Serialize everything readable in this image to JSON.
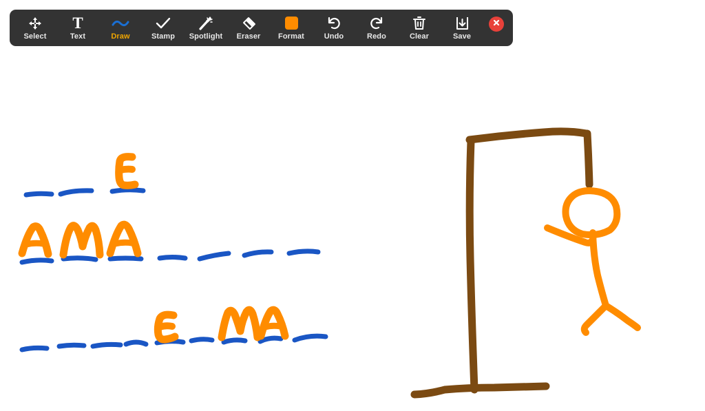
{
  "app": {
    "title": "Zoom Annotation Whiteboard",
    "canvas_background": "#ffffff"
  },
  "toolbar": {
    "background_color": "#333333",
    "active_tool": "Draw",
    "active_label_color": "#f0a500",
    "label_color": "#e8e8e8",
    "items": [
      {
        "id": "select",
        "label": "Select",
        "icon": "move-arrows-icon",
        "active": false
      },
      {
        "id": "text",
        "label": "Text",
        "icon": "text-T-icon",
        "active": false
      },
      {
        "id": "draw",
        "label": "Draw",
        "icon": "squiggle-line-icon",
        "active": true
      },
      {
        "id": "stamp",
        "label": "Stamp",
        "icon": "checkmark-icon",
        "active": false
      },
      {
        "id": "spotlight",
        "label": "Spotlight",
        "icon": "magic-wand-icon",
        "active": false
      },
      {
        "id": "eraser",
        "label": "Eraser",
        "icon": "eraser-icon",
        "active": false
      },
      {
        "id": "format",
        "label": "Format",
        "icon": "color-swatch-icon",
        "active": false
      },
      {
        "id": "undo",
        "label": "Undo",
        "icon": "undo-arrow-icon",
        "active": false
      },
      {
        "id": "redo",
        "label": "Redo",
        "icon": "redo-arrow-icon",
        "active": false
      },
      {
        "id": "clear",
        "label": "Clear",
        "icon": "trash-can-icon",
        "active": false
      },
      {
        "id": "save",
        "label": "Save",
        "icon": "save-download-icon",
        "active": false
      }
    ],
    "close_button": {
      "icon": "close-x-icon",
      "background_color": "#e8413a",
      "glyph_color": "#ffffff"
    },
    "format_swatch_color": "#ff8c00"
  },
  "drawing": {
    "description": "Hand-drawn hangman game on a whiteboard",
    "ink_colors": {
      "letters": "#ff8c00",
      "blanks": "#1a56c4",
      "gallows": "#7b4a12"
    },
    "puzzle": {
      "rows": [
        {
          "row": 1,
          "slots": [
            "",
            "",
            "E"
          ]
        },
        {
          "row": 2,
          "slots": [
            "A",
            "M",
            "A",
            "",
            "",
            "",
            ""
          ]
        },
        {
          "row": 3,
          "slots": [
            "",
            "",
            "",
            "",
            "E",
            "",
            "M",
            "A",
            ""
          ]
        }
      ]
    },
    "hangman": {
      "gallows_parts": [
        "base",
        "vertical-post",
        "top-beam",
        "short-rope"
      ],
      "figure_parts": [
        "head",
        "body",
        "left-arm",
        "left-leg",
        "right-leg"
      ]
    }
  }
}
